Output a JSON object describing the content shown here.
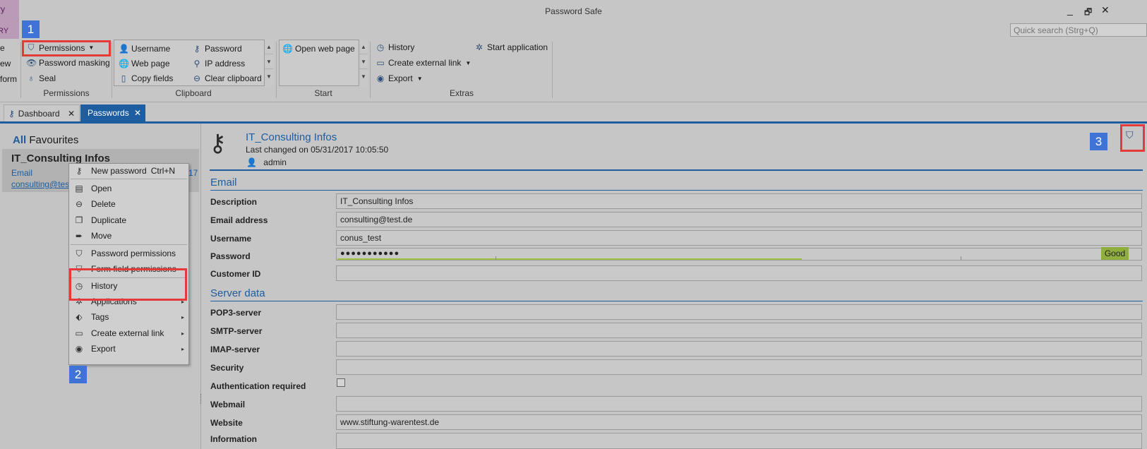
{
  "window": {
    "title": "Password Safe",
    "app_tab_top": "ry",
    "app_tab_bottom": "RY",
    "minimize": "_",
    "restore": "🗗",
    "close": "✕"
  },
  "quick_search": {
    "placeholder": "Quick search (Strg+Q)"
  },
  "ribbon": {
    "cut_left": [
      "e",
      "ew",
      "form"
    ],
    "permissions_group": {
      "label": "Permissions",
      "items": [
        {
          "label": "Permissions",
          "icon": "shield-icon"
        },
        {
          "label": "Password masking",
          "icon": "eye-icon"
        },
        {
          "label": "Seal",
          "icon": "seal-icon"
        }
      ]
    },
    "clipboard_group": {
      "label": "Clipboard",
      "col1": [
        {
          "label": "Username",
          "icon": "user-icon"
        },
        {
          "label": "Web page",
          "icon": "globe-icon"
        },
        {
          "label": "Copy fields",
          "icon": "copy-icon"
        }
      ],
      "col2": [
        {
          "label": "Password",
          "icon": "key-icon"
        },
        {
          "label": "IP address",
          "icon": "network-icon"
        },
        {
          "label": "Clear clipboard",
          "icon": "minus-circle-icon"
        }
      ]
    },
    "start_group": {
      "label": "Start",
      "items": [
        {
          "label": "Open web page",
          "icon": "globe-icon"
        }
      ]
    },
    "extras_group": {
      "label": "Extras",
      "col1": [
        {
          "label": "History",
          "icon": "history-icon"
        },
        {
          "label": "Create external link",
          "icon": "monitor-icon"
        },
        {
          "label": "Export",
          "icon": "export-icon"
        }
      ],
      "col2": [
        {
          "label": "Start application",
          "icon": "aperture-icon"
        }
      ]
    }
  },
  "badges": {
    "one": "1",
    "two": "2",
    "three": "3"
  },
  "tabs": [
    {
      "label": "Dashboard",
      "icon": "key-icon",
      "close": "✕"
    },
    {
      "label": "Passwords",
      "close": "✕"
    }
  ],
  "left": {
    "filter_all": "All",
    "filter_fav": "Favourites",
    "item": {
      "title": "IT_Consulting Infos",
      "type": "Email",
      "email": "consulting@test.de",
      "date_fragment": "17"
    }
  },
  "context_menu": {
    "items": [
      {
        "label": "New password",
        "shortcut": "Ctrl+N",
        "icon": "new-password-icon"
      },
      {
        "label": "Open",
        "icon": "open-icon"
      },
      {
        "label": "Delete",
        "icon": "delete-icon"
      },
      {
        "label": "Duplicate",
        "icon": "duplicate-icon"
      },
      {
        "label": "Move",
        "icon": "move-icon"
      },
      {
        "label": "Password permissions",
        "icon": "shield-icon"
      },
      {
        "label": "Form field permissions",
        "icon": "shield-icon"
      },
      {
        "label": "History",
        "icon": "history-icon"
      },
      {
        "label": "Applications",
        "icon": "aperture-icon"
      },
      {
        "label": "Tags",
        "icon": "tag-icon"
      },
      {
        "label": "Create external link",
        "icon": "monitor-icon"
      },
      {
        "label": "Export",
        "icon": "export-icon"
      }
    ]
  },
  "detail": {
    "title": "IT_Consulting Infos",
    "last_changed": "Last changed on 05/31/2017 10:05:50",
    "user": "admin",
    "sections": [
      {
        "heading": "Email",
        "fields": [
          {
            "label": "Description",
            "value": "IT_Consulting Infos"
          },
          {
            "label": "Email address",
            "value": "consulting@test.de"
          },
          {
            "label": "Username",
            "value": "conus_test"
          },
          {
            "label": "Password",
            "value": "●●●●●●●●●●●",
            "strength": "Good"
          },
          {
            "label": "Customer ID",
            "value": ""
          }
        ]
      },
      {
        "heading": "Server data",
        "fields": [
          {
            "label": "POP3-server",
            "value": ""
          },
          {
            "label": "SMTP-server",
            "value": ""
          },
          {
            "label": "IMAP-server",
            "value": ""
          },
          {
            "label": "Security",
            "value": ""
          },
          {
            "label": "Authentication required",
            "value": ""
          },
          {
            "label": "Webmail",
            "value": ""
          },
          {
            "label": "Website",
            "value": "www.stiftung-warentest.de"
          },
          {
            "label": "Information",
            "value": ""
          }
        ]
      }
    ]
  },
  "colors": {
    "accent": "#1d5da0",
    "highlight_red": "#e53a3a",
    "badge_blue": "#3f74d6",
    "strength_green": "#8fae3d",
    "app_purple": "#b99bb8"
  }
}
